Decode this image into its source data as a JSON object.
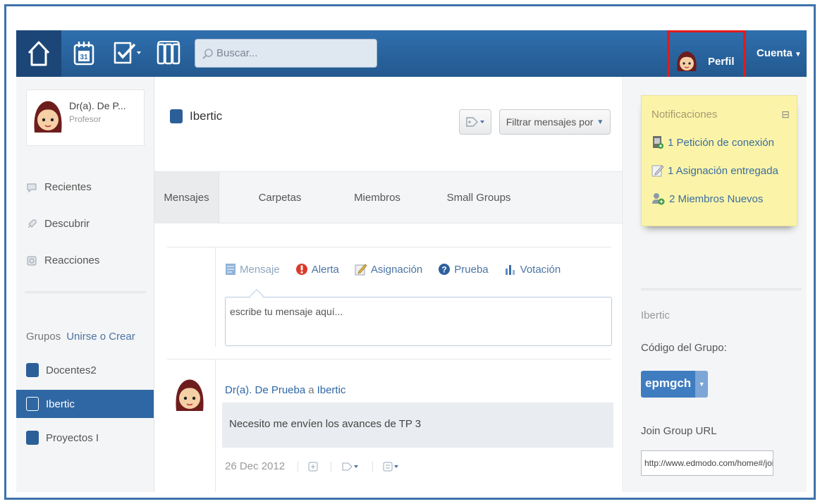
{
  "topbar": {
    "search_placeholder": "Buscar...",
    "profile_label": "Perfil",
    "account_label": "Cuenta",
    "calendar_day": "31"
  },
  "sidebar": {
    "user_name": "Dr(a). De P...",
    "user_role": "Profesor",
    "nav": [
      {
        "label": "Recientes",
        "icon": "speech-bubble-icon"
      },
      {
        "label": "Descubrir",
        "icon": "rocket-icon"
      },
      {
        "label": "Reacciones",
        "icon": "reaction-icon"
      }
    ],
    "groups_label": "Grupos",
    "join_create_label": "Unirse o Crear",
    "groups": [
      {
        "label": "Docentes2",
        "active": false
      },
      {
        "label": "Ibertic",
        "active": true
      },
      {
        "label": "Proyectos I",
        "active": false
      }
    ]
  },
  "center": {
    "group_title": "Ibertic",
    "filter_label": "Filtrar mensajes por",
    "tabs": [
      "Mensajes",
      "Carpetas",
      "Miembros",
      "Small Groups"
    ],
    "post_types": [
      "Mensaje",
      "Alerta",
      "Asignación",
      "Prueba",
      "Votación"
    ],
    "message_placeholder": "escribe tu mensaje aquí...",
    "post": {
      "author": "Dr(a). De Prueba",
      "connector": "a",
      "target": "Ibertic",
      "body": "Necesito me envíen los avances de TP 3",
      "date": "26 Dec 2012"
    }
  },
  "right": {
    "notifications_title": "Notificaciones",
    "notifications": [
      "1 Petición de conexión",
      "1 Asignación entregada",
      "2 Miembros Nuevos"
    ],
    "group_name": "Ibertic",
    "group_code_label": "Código del Grupo:",
    "group_code": "epmgch",
    "join_url_label": "Join Group URL",
    "join_url": "http://www.edmodo.com/home#/joir"
  },
  "colors": {
    "topbar": "#2f6fae",
    "highlight": "#e11b1b",
    "active_group": "#2f67a4",
    "notification_bg": "#fbf4a8"
  }
}
